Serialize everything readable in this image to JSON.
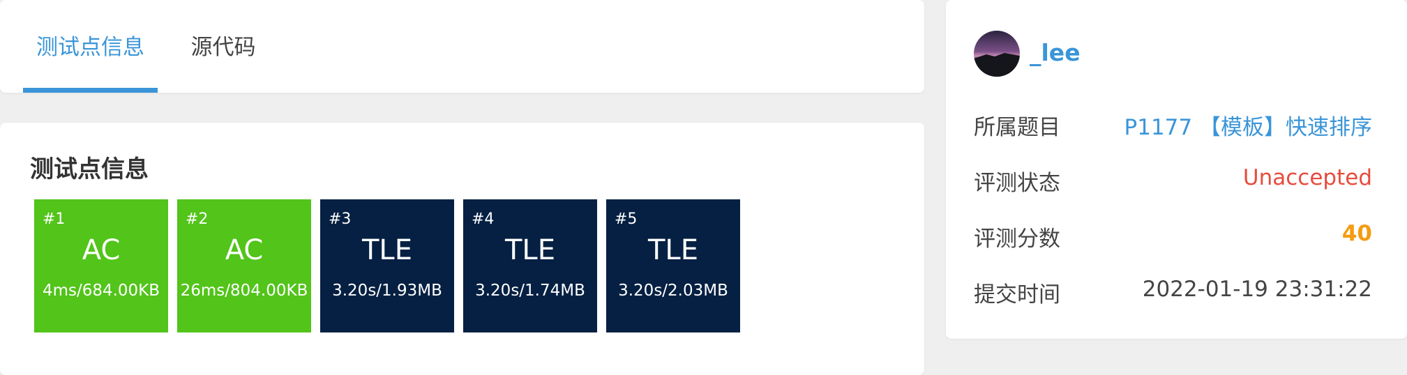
{
  "tabs": [
    {
      "label": "测试点信息",
      "active": true
    },
    {
      "label": "源代码",
      "active": false
    }
  ],
  "testcases": {
    "title": "测试点信息",
    "items": [
      {
        "num": "#1",
        "status": "AC",
        "usage": "4ms/684.00KB",
        "color": "#52c41a"
      },
      {
        "num": "#2",
        "status": "AC",
        "usage": "26ms/804.00KB",
        "color": "#52c41a"
      },
      {
        "num": "#3",
        "status": "TLE",
        "usage": "3.20s/1.93MB",
        "color": "#052042"
      },
      {
        "num": "#4",
        "status": "TLE",
        "usage": "3.20s/1.74MB",
        "color": "#052042"
      },
      {
        "num": "#5",
        "status": "TLE",
        "usage": "3.20s/2.03MB",
        "color": "#052042"
      }
    ]
  },
  "user": {
    "name": "_lee",
    "avatar_icon": "user-avatar-image"
  },
  "details": [
    {
      "label": "所属题目",
      "value": "P1177 【模板】快速排序",
      "color": "#3a95d8"
    },
    {
      "label": "评测状态",
      "value": "Unaccepted",
      "color": "#e74c3c"
    },
    {
      "label": "评测分数",
      "value": "40",
      "color": "#f39c12"
    },
    {
      "label": "提交时间",
      "value": "2022-01-19 23:31:22",
      "color": "#444444"
    }
  ],
  "colors": {
    "accent": "#3a95d8",
    "ac": "#52c41a",
    "tle": "#052042",
    "background": "#efefef"
  }
}
